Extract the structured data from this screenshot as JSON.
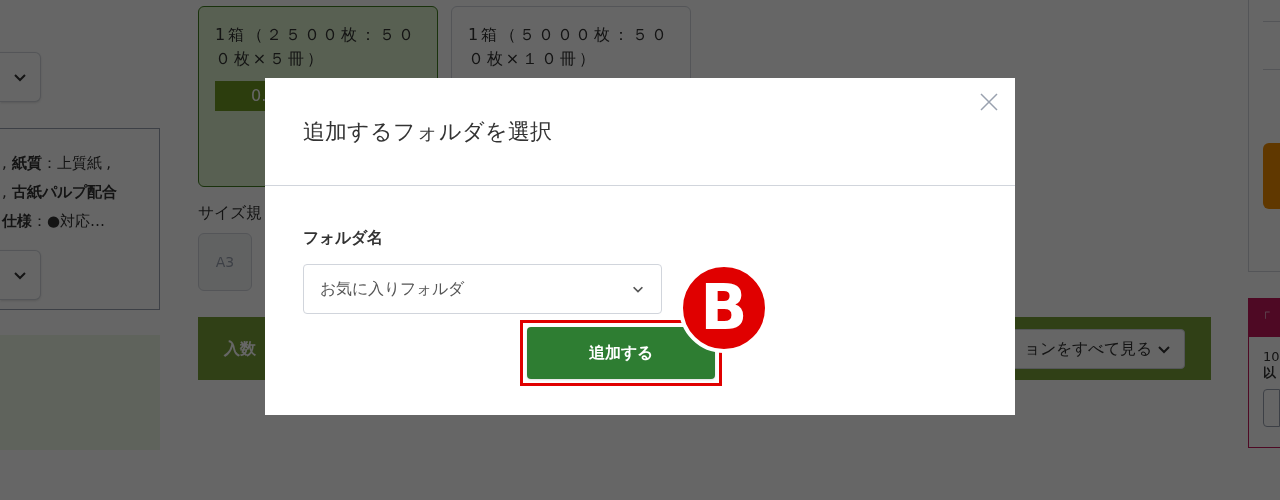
{
  "page": {
    "spec_lines": [
      ", **紙質**：上質紙 ,",
      ", **古紙パルプ配合**",
      "**仕様**：●対応…"
    ],
    "variants": [
      {
        "label": "1箱（２５００枚：５００枚×５冊）",
        "selected": true,
        "price": "0."
      },
      {
        "label": "1箱（５０００枚：５００枚×１０冊）",
        "selected": false
      }
    ],
    "size_label": "サイズ規",
    "sizes": [
      {
        "label": "A3",
        "disabled": true
      }
    ],
    "quantity_bar": {
      "label": "入数",
      "toggle": "ョンをすべて見る"
    },
    "side_box": {
      "badge": "「",
      "lines": [
        "10",
        "以"
      ]
    }
  },
  "dialog": {
    "title": "追加するフォルダを選択",
    "field_label": "フォルダ名",
    "folder_select": {
      "value": "お気に入りフォルダ"
    },
    "submit": "追加する"
  },
  "annotation": {
    "marker": "B"
  }
}
